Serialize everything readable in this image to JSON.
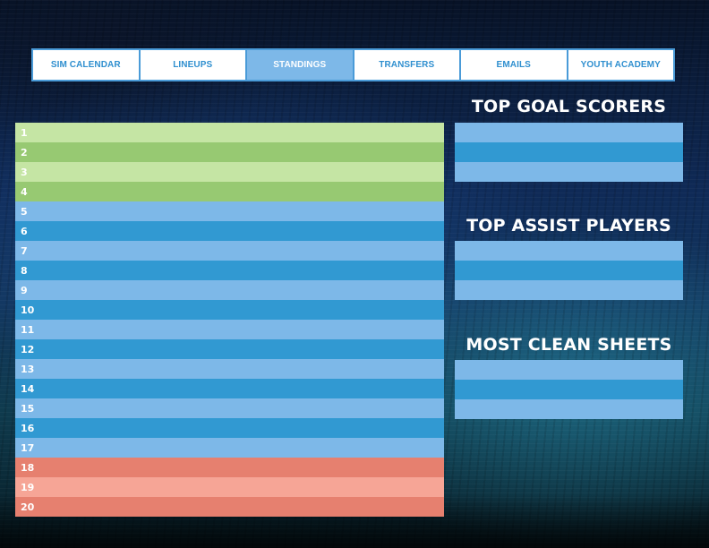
{
  "nav": {
    "tabs": [
      {
        "label": "SIM CALENDAR",
        "active": false
      },
      {
        "label": "LINEUPS",
        "active": false
      },
      {
        "label": "STANDINGS",
        "active": true
      },
      {
        "label": "TRANSFERS",
        "active": false
      },
      {
        "label": "EMAILS",
        "active": false
      },
      {
        "label": "YOUTH ACADEMY",
        "active": false
      }
    ]
  },
  "standings": {
    "rows": [
      {
        "pos": "1"
      },
      {
        "pos": "2"
      },
      {
        "pos": "3"
      },
      {
        "pos": "4"
      },
      {
        "pos": "5"
      },
      {
        "pos": "6"
      },
      {
        "pos": "7"
      },
      {
        "pos": "8"
      },
      {
        "pos": "9"
      },
      {
        "pos": "10"
      },
      {
        "pos": "11"
      },
      {
        "pos": "12"
      },
      {
        "pos": "13"
      },
      {
        "pos": "14"
      },
      {
        "pos": "15"
      },
      {
        "pos": "16"
      },
      {
        "pos": "17"
      },
      {
        "pos": "18"
      },
      {
        "pos": "19"
      },
      {
        "pos": "20"
      }
    ]
  },
  "panels": {
    "top_goal_scorers": {
      "title": "TOP GOAL SCORERS"
    },
    "top_assist_players": {
      "title": "TOP ASSIST PLAYERS"
    },
    "most_clean_sheets": {
      "title": "MOST CLEAN SHEETS"
    }
  },
  "colors": {
    "promotion_light": "#c5e5a4",
    "promotion_dark": "#97c972",
    "mid_light": "#7db8e8",
    "mid_dark": "#3199d2",
    "relegation_dark": "#e6806f",
    "relegation_light": "#f6a596",
    "nav_border": "#4a9bd8"
  }
}
